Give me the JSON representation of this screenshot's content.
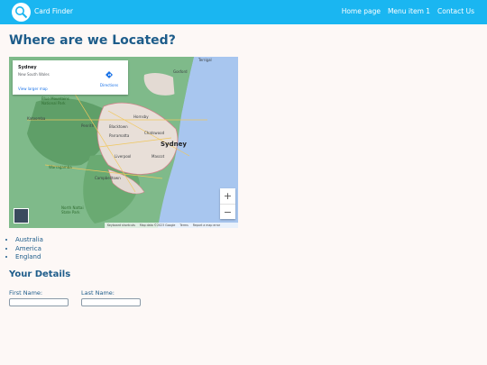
{
  "header": {
    "brand": "Card Finder",
    "nav": [
      "Home page",
      "Menu item 1",
      "Contact Us"
    ]
  },
  "page_title": "Where are we Located?",
  "map": {
    "place_name": "Sydney",
    "place_region": "New South Wales",
    "directions_label": "Directions",
    "larger_map_label": "View larger map",
    "labels": {
      "sydney": "Sydney",
      "katoomba": "Katoomba",
      "blue_mountains": "Blue Mountains National Park",
      "penrith": "Penrith",
      "blacktown": "Blacktown",
      "parramatta": "Parramatta",
      "hornsby": "Hornsby",
      "chatswood": "Chatswood",
      "gosford": "Gosford",
      "liverpool": "Liverpool",
      "mascot": "Mascot",
      "warragamba": "Warragamba",
      "campbelltown": "Campbelltown",
      "north_nattai": "North Nattai State Park",
      "terrigal": "Terrigal"
    },
    "zoom_in": "+",
    "zoom_out": "−",
    "footer": [
      "Keyboard shortcuts",
      "Map data ©2023 Google",
      "Terms",
      "Report a map error"
    ]
  },
  "countries": [
    "Australia",
    "America",
    "England"
  ],
  "details": {
    "heading": "Your Details",
    "first_name_label": "First Name:",
    "last_name_label": "Last Name:",
    "first_name_value": "",
    "last_name_value": ""
  }
}
